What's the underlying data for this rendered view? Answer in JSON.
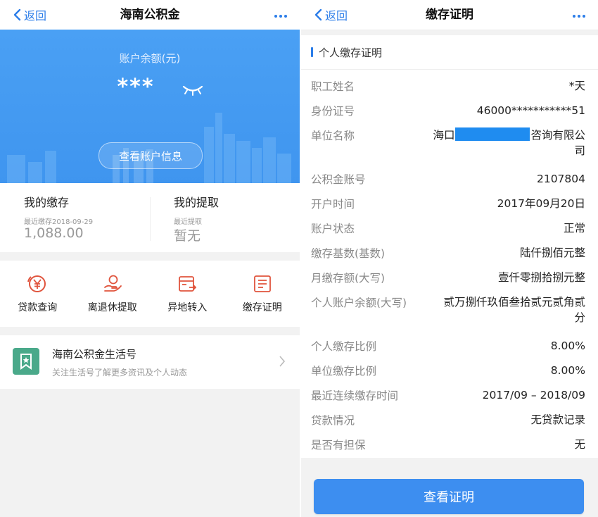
{
  "left": {
    "nav": {
      "back": "返回",
      "title": "海南公积金"
    },
    "hero": {
      "balance_label": "账户余额(元)",
      "balance_masked": "***",
      "view_button": "查看账户信息"
    },
    "deposit": {
      "title": "我的缴存",
      "sub": "最近缴存2018-09-29",
      "value": "1,088.00"
    },
    "withdraw": {
      "title": "我的提取",
      "sub": "最近提取",
      "value": "暂无"
    },
    "quick_actions": [
      {
        "label": "贷款查询",
        "icon": "yuan-coin-icon"
      },
      {
        "label": "离退休提取",
        "icon": "hand-coin-icon"
      },
      {
        "label": "异地转入",
        "icon": "card-transfer-icon"
      },
      {
        "label": "缴存证明",
        "icon": "certificate-icon"
      }
    ],
    "life": {
      "title": "海南公积金生活号",
      "subtitle": "关注生活号了解更多资讯及个人动态",
      "icon": "bookmark-star-icon"
    }
  },
  "right": {
    "nav": {
      "back": "返回",
      "title": "缴存证明"
    },
    "section_title": "个人缴存证明",
    "fields": [
      {
        "label": "职工姓名",
        "value": "*天"
      },
      {
        "label": "身份证号",
        "value": "46000***********51"
      },
      {
        "label": "单位名称",
        "value_prefix": "海口",
        "value_line1_suffix": "咨询有限公",
        "value_line2": "司",
        "redacted": true
      },
      {
        "label": "公积金账号",
        "value": "2107804"
      },
      {
        "label": "开户时间",
        "value": "2017年09月20日"
      },
      {
        "label": "账户状态",
        "value": "正常"
      },
      {
        "label": "缴存基数(基数)",
        "value": "陆仟捌佰元整"
      },
      {
        "label": "月缴存额(大写)",
        "value": "壹仟零捌拾捌元整"
      },
      {
        "label": "个人账户余额(大写)",
        "value_line1": "贰万捌仟玖佰叁拾贰元贰角贰",
        "value_line2": "分"
      },
      {
        "label": "个人缴存比例",
        "value": "8.00%"
      },
      {
        "label": "单位缴存比例",
        "value": "8.00%"
      },
      {
        "label": "最近连续缴存时间",
        "value": "2017/09 – 2018/09"
      },
      {
        "label": "贷款情况",
        "value": "无贷款记录"
      },
      {
        "label": "是否有担保",
        "value": "无"
      }
    ],
    "submit": "查看证明"
  },
  "colors": {
    "accent": "#2b7de9",
    "hero": "#4aa0f4",
    "action_red": "#e0543d",
    "life_green": "#4aa98a"
  }
}
